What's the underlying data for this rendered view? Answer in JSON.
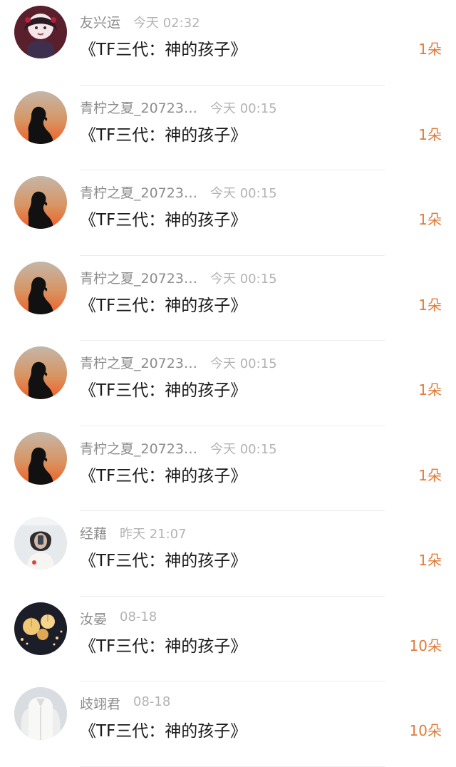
{
  "gift_list": [
    {
      "name": "友兴运",
      "time": "今天 02:32",
      "book": "《TF三代：神的孩子》",
      "amount": "1朵",
      "avatar": "anime-avatar-icon"
    },
    {
      "name": "青柠之夏_20723…",
      "time": "今天 00:15",
      "book": "《TF三代：神的孩子》",
      "amount": "1朵",
      "avatar": "sunset-silhouette-avatar-icon"
    },
    {
      "name": "青柠之夏_20723…",
      "time": "今天 00:15",
      "book": "《TF三代：神的孩子》",
      "amount": "1朵",
      "avatar": "sunset-silhouette-avatar-icon"
    },
    {
      "name": "青柠之夏_20723…",
      "time": "今天 00:15",
      "book": "《TF三代：神的孩子》",
      "amount": "1朵",
      "avatar": "sunset-silhouette-avatar-icon"
    },
    {
      "name": "青柠之夏_20723…",
      "time": "今天 00:15",
      "book": "《TF三代：神的孩子》",
      "amount": "1朵",
      "avatar": "sunset-silhouette-avatar-icon"
    },
    {
      "name": "青柠之夏_20723…",
      "time": "今天 00:15",
      "book": "《TF三代：神的孩子》",
      "amount": "1朵",
      "avatar": "sunset-silhouette-avatar-icon"
    },
    {
      "name": "经藉",
      "time": "昨天 21:07",
      "book": "《TF三代：神的孩子》",
      "amount": "1朵",
      "avatar": "girl-photo-avatar-icon"
    },
    {
      "name": "汝晏",
      "time": "08-18",
      "book": "《TF三代：神的孩子》",
      "amount": "10朵",
      "avatar": "lanterns-avatar-icon"
    },
    {
      "name": "歧翊君",
      "time": "08-18",
      "book": "《TF三代：神的孩子》",
      "amount": "10朵",
      "avatar": "white-shirt-avatar-icon"
    }
  ],
  "colors": {
    "amount": "#e07b39",
    "name": "#8c8c8c",
    "time": "#b3b3b3",
    "title": "#1a1a1a",
    "divider": "#ececec"
  }
}
